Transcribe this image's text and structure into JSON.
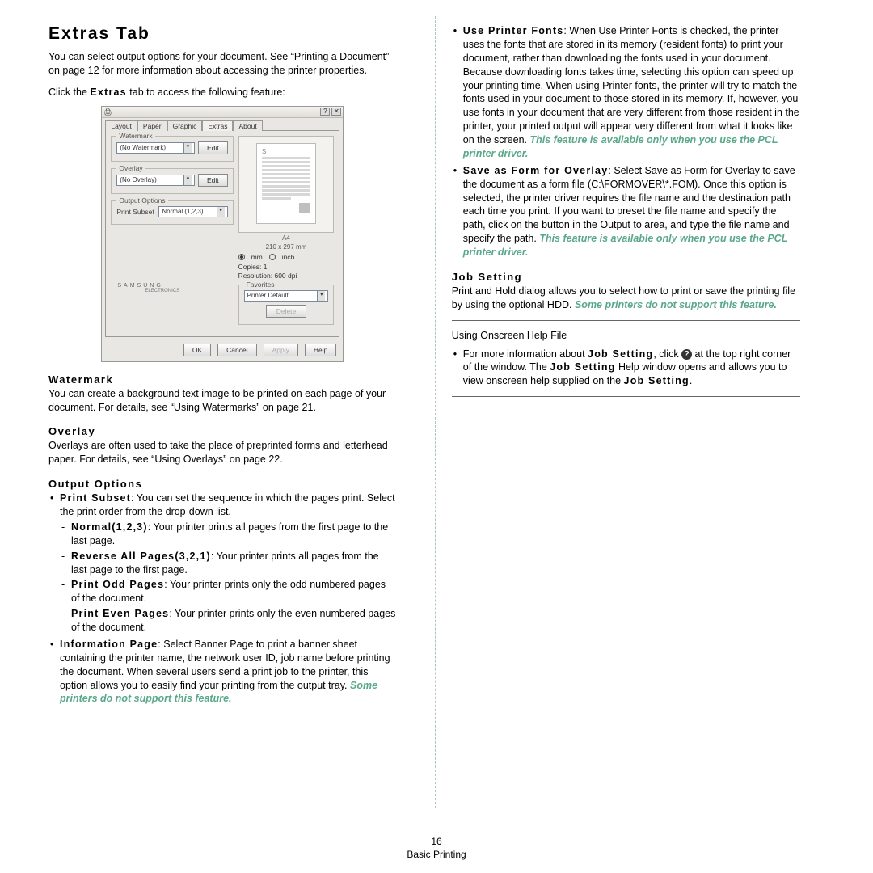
{
  "footer": {
    "page_num": "16",
    "section": "Basic Printing"
  },
  "left": {
    "h1": "Extras Tab",
    "intro1": "You can select output options for your document. See “Printing a Document” on page 12 for more information about accessing the printer properties.",
    "intro2_a": "Click the ",
    "intro2_b": "Extras",
    "intro2_c": " tab to access the following feature:",
    "watermark_h": "Watermark",
    "watermark_p": "You can create a background text image to be printed on each page of your document. For details, see “Using Watermarks” on page 21.",
    "overlay_h": "Overlay",
    "overlay_p": "Overlays are often used to take the place of preprinted forms and letterhead paper. For details, see “Using Overlays” on page 22.",
    "output_h": "Output Options",
    "ps_label": "Print Subset",
    "ps_text": ": You can set the sequence in which the pages print. Select the print order from the drop-down list.",
    "normal_label": "Normal(1,2,3)",
    "normal_text": ": Your printer prints all pages from the first page to the last page.",
    "reverse_label": "Reverse All Pages(3,2,1)",
    "reverse_text": ": Your printer prints all pages from the last page to the first page.",
    "odd_label": "Print Odd Pages",
    "odd_text": ": Your printer prints only the odd numbered pages of the document.",
    "even_label": "Print Even Pages",
    "even_text": ": Your printer prints only the even numbered pages of the document.",
    "info_label": "Information Page",
    "info_text": ": Select Banner Page to print a banner sheet containing the printer name, the network user ID, job name before printing the document. When several users send a print job to the printer, this option allows you to easily find your printing from the output tray. ",
    "info_green": "Some printers do not support this feature."
  },
  "right": {
    "upf_label": "Use Printer Fonts",
    "upf_text": ": When Use Printer Fonts is checked, the printer uses the fonts that are stored in its memory (resident fonts) to print your document, rather than downloading the fonts used in your document. Because downloading fonts takes time, selecting this option can speed up your printing time. When using Printer fonts, the printer will try to match the fonts used in your document to those stored in its memory. If, however, you use fonts in your document that are very different from those resident in the printer, your printed output will appear very different from what it looks like on the screen. ",
    "upf_green": "This feature is available only when you use the PCL printer driver.",
    "safo_label": "Save as Form for Overlay",
    "safo_text": ": Select Save as Form for Overlay to save the document as a form file (C:\\FORMOVER\\*.FOM). Once this option is selected, the printer driver requires the file name and the destination path each time you print. If you want to preset the file name and specify the path, click on the button in the Output to area, and type the file name and specify the path. ",
    "safo_green": "This feature is available only when you use the PCL printer driver.",
    "job_h": "Job Setting",
    "job_text": "Print and Hold dialog allows you to select how to print or save the printing file by using the optional HDD. ",
    "job_green": "Some printers do not support this feature.",
    "help_h": "Using Onscreen Help File",
    "help_a": "For more information about ",
    "help_b": "Job Setting",
    "help_c": ", click ",
    "help_d": " at the top right corner of the window. The ",
    "help_e": "Job Setting",
    "help_f": " Help window opens and allows you to view onscreen help supplied on the ",
    "help_g": "Job Setting",
    "help_h_end": "."
  },
  "dialog": {
    "tabs": [
      "Layout",
      "Paper",
      "Graphic",
      "Extras",
      "About"
    ],
    "watermark_label": "Watermark",
    "watermark_sel": "(No Watermark)",
    "edit": "Edit",
    "overlay_label": "Overlay",
    "overlay_sel": "(No Overlay)",
    "output_label": "Output Options",
    "ps_lbl": "Print Subset",
    "ps_sel": "Normal (1,2,3)",
    "paper_name": "A4",
    "paper_dim": "210 x 297 mm",
    "unit_mm": "mm",
    "unit_inch": "inch",
    "copies": "Copies: 1",
    "resolution": "Resolution: 600 dpi",
    "favorites": "Favorites",
    "fav_sel": "Printer Default",
    "delete": "Delete",
    "logo": "SAMSUNG",
    "logo_sub": "ELECTRONICS",
    "ok": "OK",
    "cancel": "Cancel",
    "apply": "Apply",
    "help": "Help",
    "q": "?",
    "x": "✕"
  }
}
